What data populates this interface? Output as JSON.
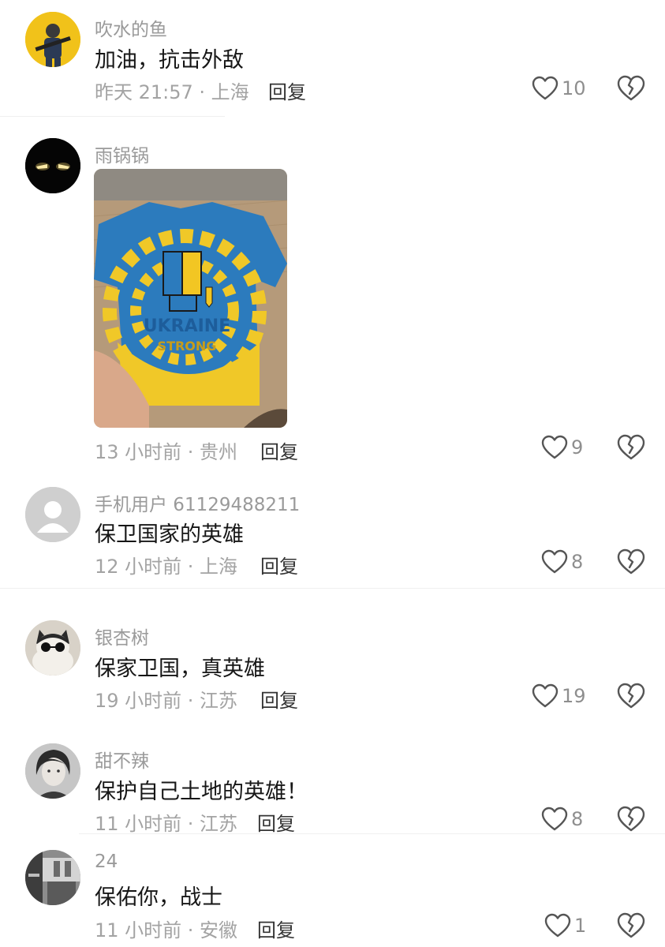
{
  "comments": [
    {
      "username": "吹水的鱼",
      "text": "加油，抗击外敌",
      "meta": "昨天 21:57 · 上海",
      "reply": "回复",
      "likes": "10"
    },
    {
      "username": "雨锅锅",
      "text": "",
      "meta": "13 小时前 · 贵州",
      "reply": "回复",
      "likes": "9",
      "image": {
        "print_line1": "UKRAINE",
        "print_line2": "STRONG"
      }
    },
    {
      "username": "手机用户 61129488211",
      "text": "保卫国家的英雄",
      "meta": "12 小时前 · 上海",
      "reply": "回复",
      "likes": "8"
    },
    {
      "username": "银杏树",
      "text": "保家卫国，真英雄",
      "meta": "19 小时前 · 江苏",
      "reply": "回复",
      "likes": "19"
    },
    {
      "username": "甜不辣",
      "text": "保护自己土地的英雄！",
      "meta": "11 小时前 · 江苏",
      "reply": "回复",
      "likes": "8"
    },
    {
      "username": "24",
      "text": "保佑你，战士",
      "meta": "11 小时前 · 安徽",
      "reply": "回复",
      "likes": "1"
    }
  ],
  "colors": {
    "ukraine_blue": "#1f72b8",
    "ukraine_yellow": "#f2c623",
    "meta_gray": "#a3a3a3"
  }
}
